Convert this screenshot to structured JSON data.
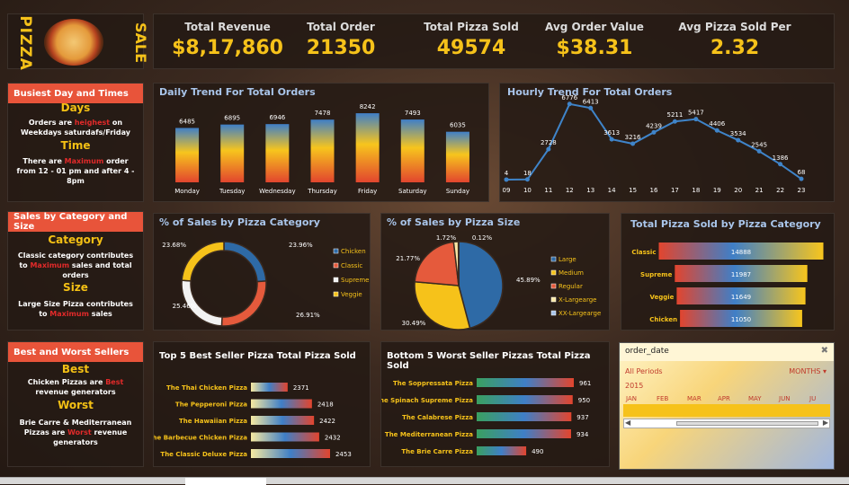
{
  "logo": {
    "left_text": "PIZZA",
    "right_text": "SALE",
    "image": "pizza-photo"
  },
  "kpis": [
    {
      "label": "Total Revenue",
      "value": "$8,17,860"
    },
    {
      "label": "Total Order",
      "value": "21350"
    },
    {
      "label": "Total Pizza Sold",
      "value": "49574"
    },
    {
      "label": "Avg Order Value",
      "value": "$38.31"
    },
    {
      "label": "Avg Pizza Sold Per",
      "value": "2.32"
    }
  ],
  "insights": {
    "busiest": {
      "header": "Busiest Day and Times",
      "days_title": "Days",
      "days_a": "Orders are ",
      "days_hl": "heighest",
      "days_b": " on Weekdays  saturdafs/Friday",
      "time_title": "Time",
      "time_a": "There are ",
      "time_hl": "Maximum",
      "time_b": " order from 12 - 01 pm and after 4 - 8pm"
    },
    "category": {
      "header": "Sales by Category and Size",
      "cat_title": "Category",
      "cat_a": "Classic category contributes to ",
      "cat_hl": "Maximum",
      "cat_b": " sales and total orders",
      "size_title": "Size",
      "size_a": "Large Size Pizza  contributes to ",
      "size_hl": "Maximum",
      "size_b": " sales"
    },
    "sellers": {
      "header": "Best and Worst Sellers",
      "best_title": "Best",
      "best_a": "Chicken Pizzas are ",
      "best_hl": "Best",
      "best_b": " revenue generators",
      "worst_title": "Worst",
      "worst_a": "Brie Carre & Mediterranean Pizzas are ",
      "worst_hl": "Worst",
      "worst_b": " revenue generators"
    }
  },
  "colors": {
    "accent_yellow": "#f6c21a",
    "header_red": "#e8543a",
    "chart_title": "#a9c5ea",
    "line_blue": "#3f84c9"
  },
  "chart_data": [
    {
      "id": "daily",
      "type": "bar",
      "title": "Daily Trend For Total Orders",
      "categories": [
        "Monday",
        "Tuesday",
        "Wednesday",
        "Thursday",
        "Friday",
        "Saturday",
        "Sunday"
      ],
      "values": [
        6485,
        6895,
        6946,
        7478,
        8242,
        7493,
        6035
      ],
      "ylim": [
        0,
        9000
      ]
    },
    {
      "id": "hourly",
      "type": "line",
      "title": "Hourly Trend For Total Orders",
      "x": [
        "09",
        "10",
        "11",
        "12",
        "13",
        "14",
        "15",
        "16",
        "17",
        "18",
        "19",
        "20",
        "21",
        "22",
        "23"
      ],
      "values": [
        4,
        18,
        2728,
        6776,
        6413,
        3613,
        3216,
        4239,
        5211,
        5417,
        4406,
        3534,
        2545,
        1386,
        68
      ],
      "ylim": [
        0,
        7000
      ]
    },
    {
      "id": "category",
      "type": "pie",
      "title": "% of Sales by Pizza Category",
      "labels": [
        "Chicken",
        "Classic",
        "Supreme",
        "Veggie"
      ],
      "values": [
        23.96,
        26.91,
        25.46,
        23.68
      ],
      "value_labels": [
        "23.96%",
        "26.91%",
        "25.46%",
        "23.68%"
      ],
      "colors": [
        "#2e6aa6",
        "#e55a3c",
        "#f2f2f2",
        "#f6c21a"
      ]
    },
    {
      "id": "size",
      "type": "pie",
      "title": "% of Sales by Pizza Size",
      "labels": [
        "Large",
        "Medium",
        "Regular",
        "X-Largearge",
        "XX-Largearge"
      ],
      "values": [
        45.89,
        30.49,
        21.77,
        1.72,
        0.12
      ],
      "value_labels": [
        "45.89%",
        "30.49%",
        "21.77%",
        "1.72%",
        "0.12%"
      ],
      "colors": [
        "#2e6aa6",
        "#f6c21a",
        "#e55a3c",
        "#fbe7a6",
        "#a9c5ea"
      ]
    },
    {
      "id": "funnel",
      "type": "bar",
      "title": "Total Pizza Sold by Pizza Category",
      "categories": [
        "Classic",
        "Supreme",
        "Veggie",
        "Chicken"
      ],
      "values": [
        14888,
        11987,
        11649,
        11050
      ]
    },
    {
      "id": "top5",
      "type": "bar",
      "title": "Top 5 Best Seller Pizza Total Pizza Sold",
      "categories": [
        "The Thai Chicken Pizza",
        "The Pepperoni Pizza",
        "The Hawaiian Pizza",
        "The Barbecue Chicken Pizza",
        "The Classic Deluxe Pizza"
      ],
      "values": [
        2371,
        2418,
        2422,
        2432,
        2453
      ]
    },
    {
      "id": "bottom5",
      "type": "bar",
      "title": "Bottom  5 Worst Seller Pizzas Total Pizza Sold",
      "categories": [
        "The Soppressata Pizza",
        "The Spinach Supreme Pizza",
        "The Calabrese Pizza",
        "The Mediterranean Pizza",
        "The Brie Carre Pizza"
      ],
      "values": [
        961,
        950,
        937,
        934,
        490
      ]
    }
  ],
  "slicer": {
    "title": "order_date",
    "range": "All Periods",
    "level": "MONTHS",
    "year": "2015",
    "months": [
      "JAN",
      "FEB",
      "MAR",
      "APR",
      "MAY",
      "JUN",
      "JU"
    ]
  }
}
